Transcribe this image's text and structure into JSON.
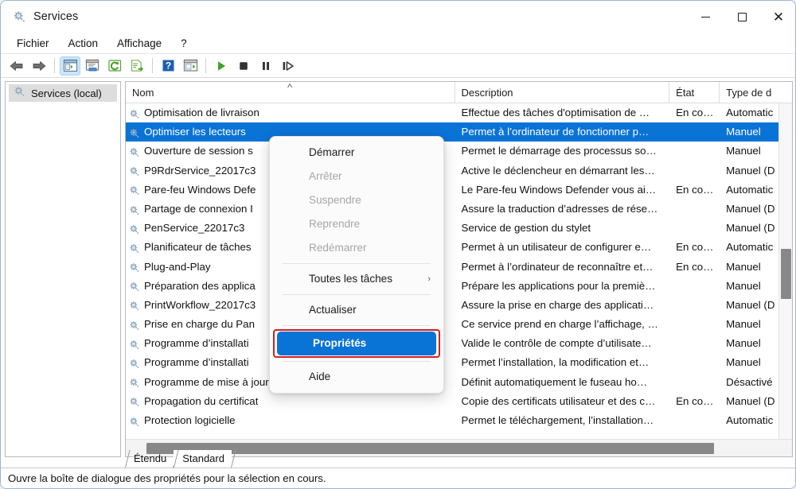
{
  "window": {
    "title": "Services",
    "icon": "services-gear-icon",
    "minimize_label": "–",
    "maximize_label": "□",
    "close_label": "✕"
  },
  "menubar": {
    "items": [
      {
        "label": "Fichier",
        "name": "menu-fichier"
      },
      {
        "label": "Action",
        "name": "menu-action"
      },
      {
        "label": "Affichage",
        "name": "menu-affichage"
      },
      {
        "label": "?",
        "name": "menu-aide"
      }
    ]
  },
  "toolbar": {
    "buttons": [
      {
        "name": "back-arrow-icon",
        "title": "Précédent"
      },
      {
        "name": "forward-arrow-icon",
        "title": "Suivant"
      },
      {
        "name": "show-hide-tree-icon",
        "title": "Afficher/Masquer l'arborescence"
      },
      {
        "name": "properties-window-icon",
        "title": "Propriétés"
      },
      {
        "name": "refresh-icon",
        "title": "Actualiser"
      },
      {
        "name": "export-list-icon",
        "title": "Exporter la liste"
      },
      {
        "name": "help-icon",
        "title": "Aide"
      },
      {
        "name": "show-action-pane-icon",
        "title": "Volet Actions"
      },
      {
        "name": "start-service-icon",
        "title": "Démarrer le service"
      },
      {
        "name": "stop-service-icon",
        "title": "Arrêter le service"
      },
      {
        "name": "pause-service-icon",
        "title": "Suspendre le service"
      },
      {
        "name": "restart-service-icon",
        "title": "Redémarrer le service"
      }
    ]
  },
  "tree": {
    "root_label": "Services (local)",
    "root_icon": "services-gear-icon"
  },
  "list": {
    "columns": [
      {
        "label": "Nom",
        "name": "column-header-nom",
        "sorted": true,
        "sort_indicator": "˄"
      },
      {
        "label": "Description",
        "name": "column-header-description"
      },
      {
        "label": "État",
        "name": "column-header-etat"
      },
      {
        "label": "Type de d",
        "name": "column-header-type-demarrage"
      }
    ],
    "rows": [
      {
        "nom": "Optimisation de livraison",
        "description": "Effectue des tâches d'optimisation de …",
        "etat": "En co…",
        "type": "Automatiс",
        "selected": false
      },
      {
        "nom": "Optimiser les lecteurs",
        "description": "Permet à l’ordinateur de fonctionner p…",
        "etat": "",
        "type": "Manuel",
        "selected": true
      },
      {
        "nom": "Ouverture de session s",
        "description": "Permet le démarrage des processus so…",
        "etat": "",
        "type": "Manuel",
        "selected": false
      },
      {
        "nom": "P9RdrService_22017c3",
        "description": "Active le déclencheur en démarrant les…",
        "etat": "",
        "type": "Manuel (D",
        "selected": false
      },
      {
        "nom": "Pare-feu Windows Defe",
        "description": "Le Pare-feu Windows Defender vous ai…",
        "etat": "En co…",
        "type": "Automatiс",
        "selected": false
      },
      {
        "nom": "Partage de connexion I",
        "description": "Assure la traduction d’adresses de rése…",
        "etat": "",
        "type": "Manuel (D",
        "selected": false
      },
      {
        "nom": "PenService_22017c3",
        "description": "Service de gestion du stylet",
        "etat": "",
        "type": "Manuel (D",
        "selected": false
      },
      {
        "nom": "Planificateur de tâches",
        "description": "Permet à un utilisateur de configurer e…",
        "etat": "En co…",
        "type": "Automatiс",
        "selected": false
      },
      {
        "nom": "Plug-and-Play",
        "description": "Permet à l’ordinateur de reconnaître et…",
        "etat": "En co…",
        "type": "Manuel",
        "selected": false
      },
      {
        "nom": "Préparation des applica",
        "description": "Prépare les applications pour la premiè…",
        "etat": "",
        "type": "Manuel",
        "selected": false
      },
      {
        "nom": "PrintWorkflow_22017c3",
        "description": "Assure la prise en charge des applicati…",
        "etat": "",
        "type": "Manuel (D",
        "selected": false
      },
      {
        "nom": "Prise en charge du Pan",
        "description": "Ce service prend en charge l’affichage, …",
        "etat": "",
        "type": "Manuel",
        "selected": false
      },
      {
        "nom": "Programme d’installati",
        "description": "Valide le contrôle de compte d’utilisate…",
        "etat": "",
        "type": "Manuel",
        "selected": false
      },
      {
        "nom": "Programme d’installati",
        "description": "Permet l’installation, la modification et…",
        "etat": "",
        "type": "Manuel",
        "selected": false
      },
      {
        "nom": "Programme de mise à jour automatique du fuseau horaire",
        "description": "Définit automatiquement le fuseau ho…",
        "etat": "",
        "type": "Désactivé",
        "selected": false
      },
      {
        "nom": "Propagation du certificat",
        "description": "Copie des certificats utilisateur et des c…",
        "etat": "En co…",
        "type": "Manuel (D",
        "selected": false
      },
      {
        "nom": "Protection logicielle",
        "description": "Permet le téléchargement, l’installation…",
        "etat": "",
        "type": "Automatiс",
        "selected": false
      }
    ]
  },
  "context_menu": {
    "items": [
      {
        "label": "Démarrer",
        "name": "ctx-demarrer",
        "disabled": false,
        "highlight": false,
        "submenu": false
      },
      {
        "label": "Arrêter",
        "name": "ctx-arreter",
        "disabled": true,
        "highlight": false,
        "submenu": false
      },
      {
        "label": "Suspendre",
        "name": "ctx-suspendre",
        "disabled": true,
        "highlight": false,
        "submenu": false
      },
      {
        "label": "Reprendre",
        "name": "ctx-reprendre",
        "disabled": true,
        "highlight": false,
        "submenu": false
      },
      {
        "label": "Redémarrer",
        "name": "ctx-redemarrer",
        "disabled": true,
        "highlight": false,
        "submenu": false
      },
      {
        "separator": true
      },
      {
        "label": "Toutes les tâches",
        "name": "ctx-toutes-les-taches",
        "disabled": false,
        "highlight": false,
        "submenu": true,
        "submenu_glyph": "›"
      },
      {
        "separator": true
      },
      {
        "label": "Actualiser",
        "name": "ctx-actualiser",
        "disabled": false,
        "highlight": false,
        "submenu": false
      },
      {
        "separator": true
      },
      {
        "label": "Propriétés",
        "name": "ctx-proprietes",
        "disabled": false,
        "highlight": true,
        "submenu": false
      },
      {
        "separator": true
      },
      {
        "label": "Aide",
        "name": "ctx-aide",
        "disabled": false,
        "highlight": false,
        "submenu": false
      }
    ]
  },
  "tabs": [
    {
      "label": "Étendu",
      "name": "tab-etendu",
      "active": false
    },
    {
      "label": "Standard",
      "name": "tab-standard",
      "active": true
    }
  ],
  "statusbar": {
    "text": "Ouvre la boîte de dialogue des propriétés pour la sélection en cours."
  },
  "colors": {
    "selection_blue": "#0a73d6",
    "highlight_red": "#d32020",
    "toolbar_active": "#cde6f7",
    "scrollbar_thumb": "#888888"
  }
}
